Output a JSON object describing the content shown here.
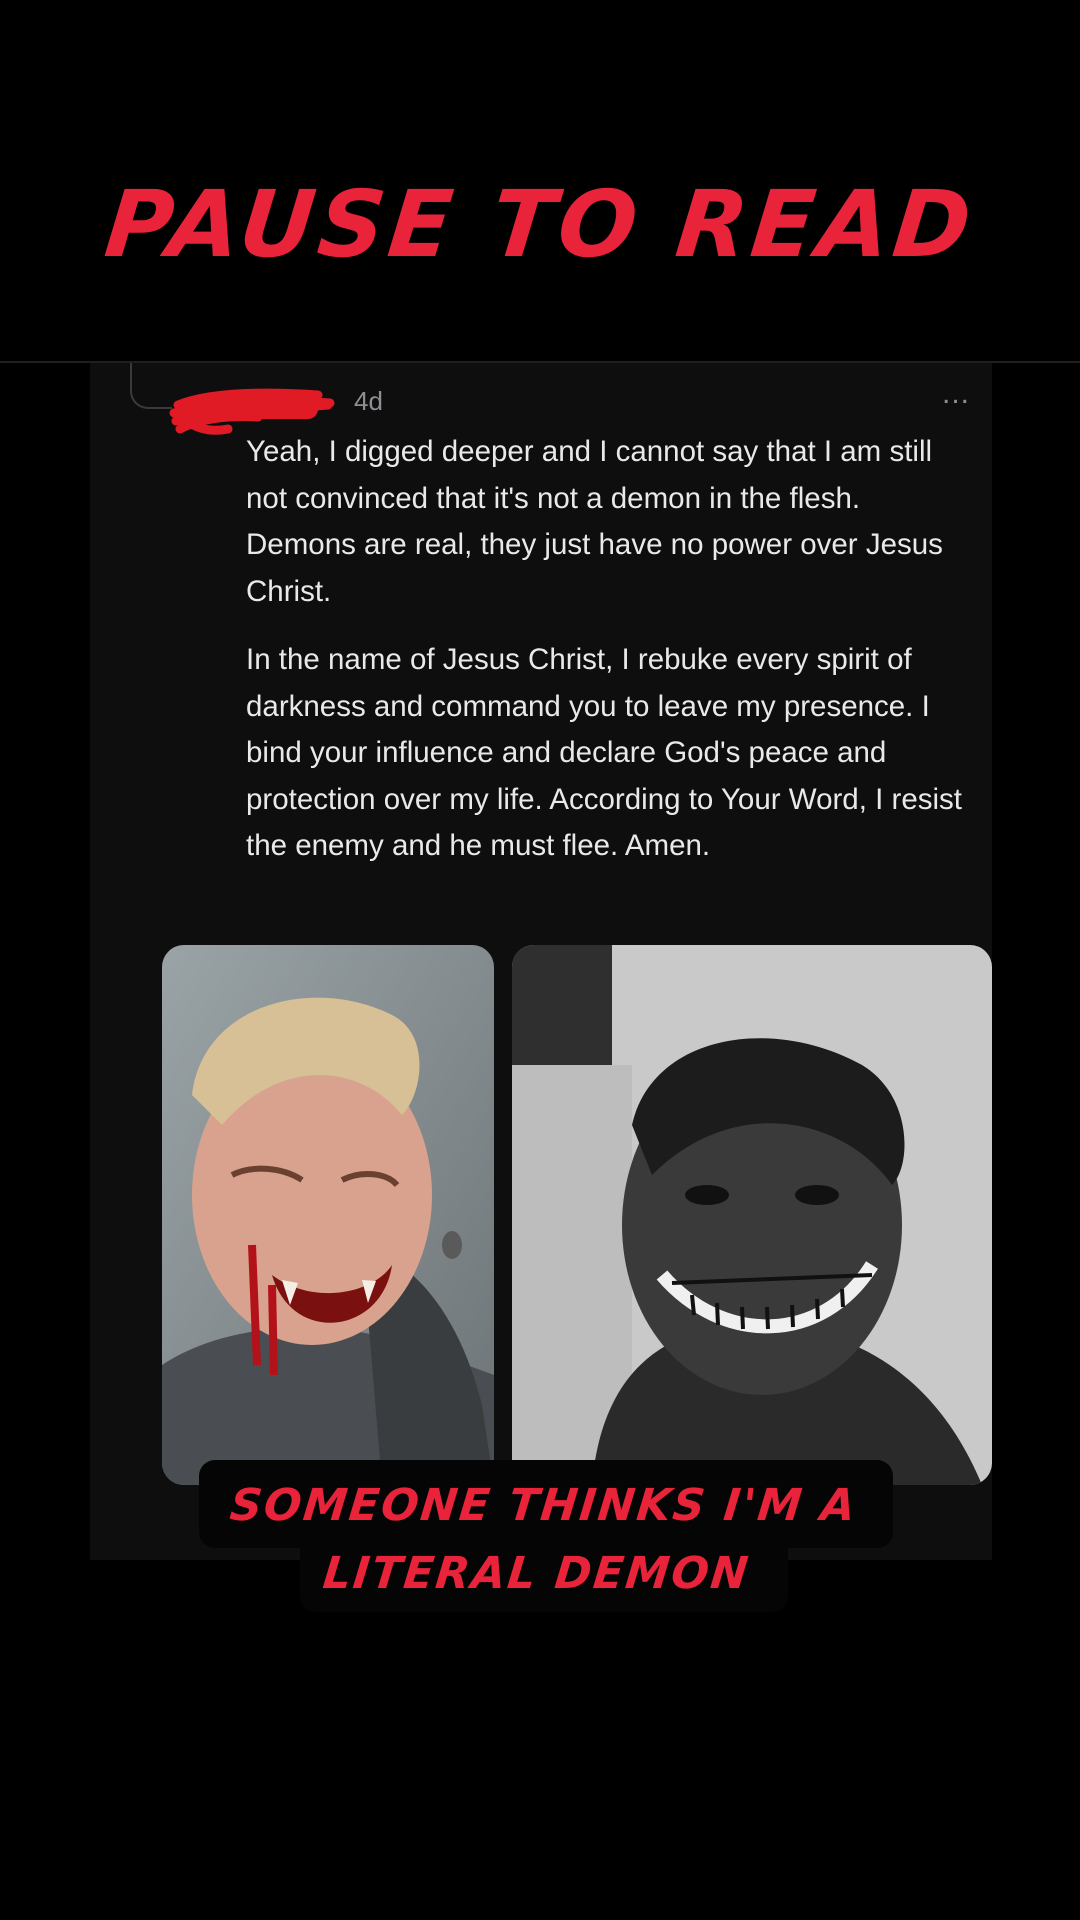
{
  "headline": "PAUSE TO READ",
  "post": {
    "timestamp": "4d",
    "more_label": "...",
    "paragraphs": [
      "Yeah, I digged deeper and I cannot say that I am still not convinced that it's not a demon in the flesh. Demons are real, they just have no power over Jesus Christ.",
      "In the name of Jesus Christ, I rebuke every spirit of darkness and command you to leave my presence. I bind your influence and declare God's peace and protection over my life. According to Your Word, I resist the enemy and he must flee. Amen."
    ]
  },
  "caption": {
    "line1": "SOMEONE THINKS I'M A",
    "line2": "LITERAL DEMON"
  },
  "colors": {
    "accent_red": "#e8233a",
    "background": "#000000",
    "card": "#0e0e0f",
    "text": "#e9e9ea",
    "muted": "#8e8e93"
  },
  "icons": {
    "more": "more-horizontal-icon",
    "thread": "thread-line-icon"
  }
}
